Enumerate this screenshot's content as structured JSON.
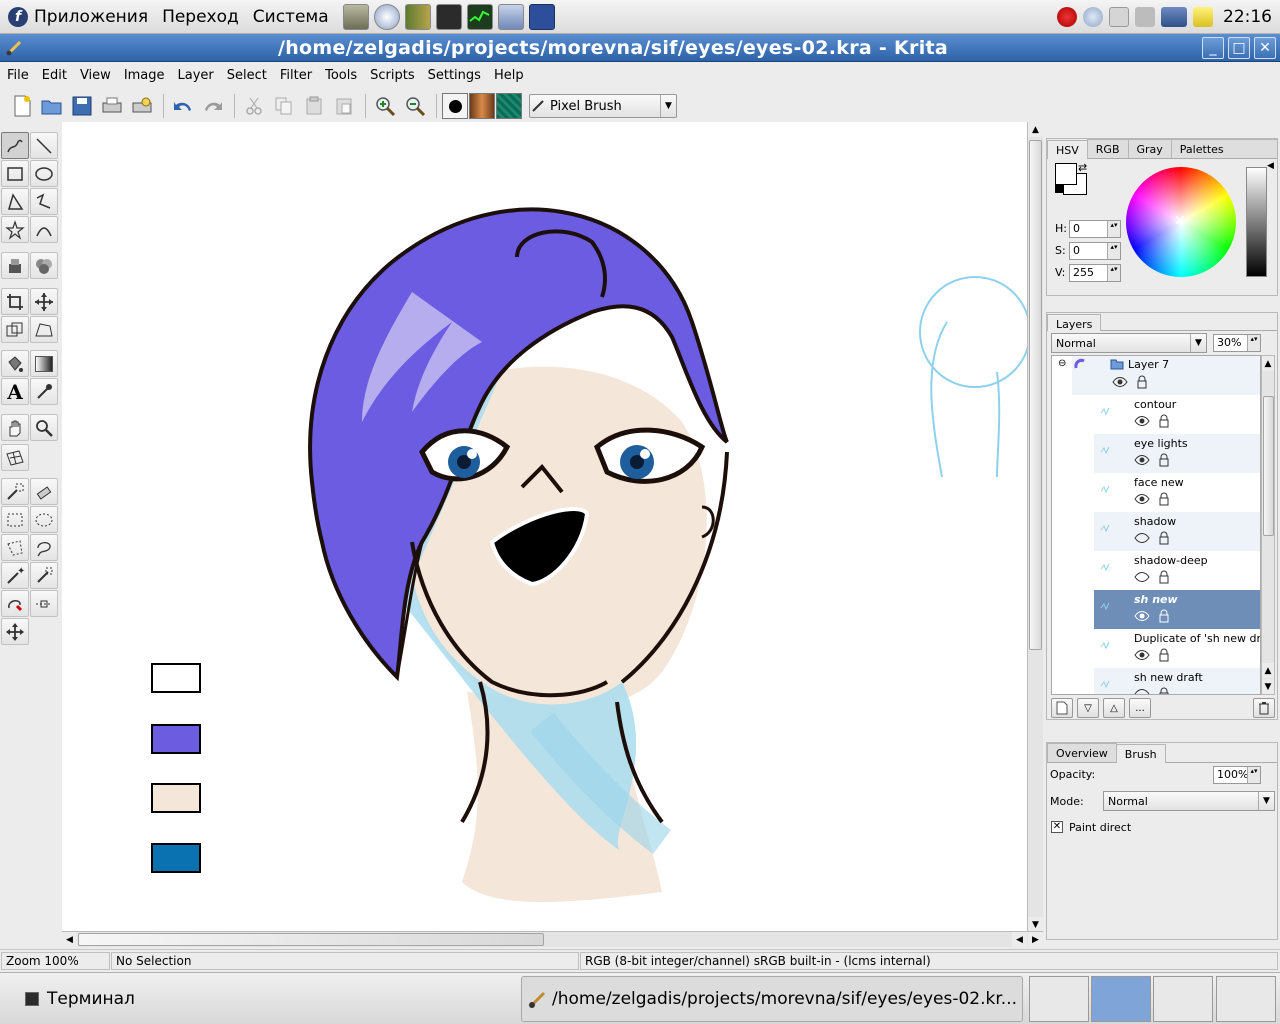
{
  "top_panel": {
    "menus": [
      "Приложения",
      "Переход",
      "Система"
    ],
    "clock": "22:16",
    "launchers": [
      "file-manager-icon",
      "network-icon",
      "book-icon",
      "terminal-icon",
      "system-monitor-icon",
      "settings-icon",
      "screen-icon"
    ],
    "tray": [
      "no-entry-icon",
      "magnifier-icon",
      "mail-icon",
      "volume-icon",
      "network-status-icon",
      "notes-icon"
    ]
  },
  "window": {
    "title": "/home/zelgadis/projects/morevna/sif/eyes/eyes-02.kra - Krita"
  },
  "menubar": [
    "File",
    "Edit",
    "View",
    "Image",
    "Layer",
    "Select",
    "Filter",
    "Tools",
    "Scripts",
    "Settings",
    "Help"
  ],
  "toolbar": {
    "brush_preset": "Pixel Brush",
    "colors": {
      "brush": "#000000",
      "gradient": "#a0522d",
      "pattern": "#0d6b55"
    }
  },
  "color_panel": {
    "tabs": [
      "HSV",
      "RGB",
      "Gray",
      "Palettes"
    ],
    "active_tab": "HSV",
    "h_label": "H:",
    "h_value": "0",
    "s_label": "S:",
    "s_value": "0",
    "v_label": "V:",
    "v_value": "255"
  },
  "layers_panel": {
    "tab": "Layers",
    "blend_mode": "Normal",
    "opacity": "30%",
    "group": "Layer 7",
    "layers": [
      {
        "name": "contour",
        "visible": true
      },
      {
        "name": "eye lights",
        "visible": true
      },
      {
        "name": "face new",
        "visible": true
      },
      {
        "name": "shadow",
        "visible": false
      },
      {
        "name": "shadow-deep",
        "visible": false
      },
      {
        "name": "sh new",
        "visible": true,
        "selected": true
      },
      {
        "name": "Duplicate of 'sh new draft'",
        "visible": true
      },
      {
        "name": "sh new draft",
        "visible": false
      }
    ],
    "more_button": "..."
  },
  "brush_panel": {
    "tabs": [
      "Overview",
      "Brush"
    ],
    "active_tab": "Brush",
    "opacity_label": "Opacity:",
    "opacity_value": "100%",
    "mode_label": "Mode:",
    "mode_value": "Normal",
    "paint_direct_label": "Paint direct",
    "paint_direct_checked": true
  },
  "canvas_swatches": [
    "#ffffff",
    "#6c5ce0",
    "#f5e6da",
    "#0a72b0"
  ],
  "statusbar": {
    "zoom": "Zoom 100%",
    "selection": "No Selection",
    "color_profile": "RGB (8-bit integer/channel)  sRGB built-in - (lcms internal)"
  },
  "taskbar": {
    "terminal_label": "Терминал",
    "krita_task": "/home/zelgadis/projects/morevna/sif/eyes/eyes-02.kr..."
  }
}
